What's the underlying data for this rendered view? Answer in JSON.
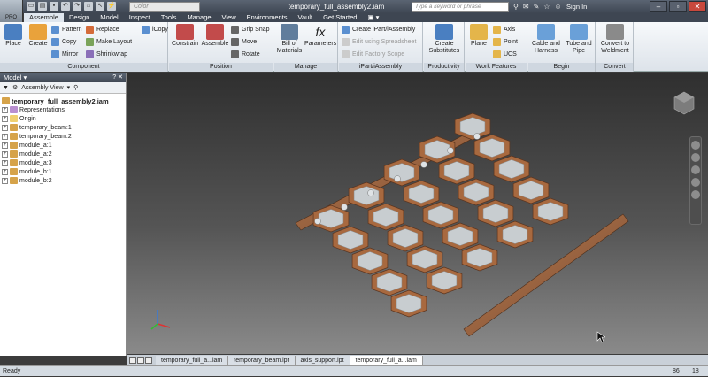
{
  "app": {
    "badge": "PRO"
  },
  "color_box": "Color",
  "document_title": "temporary_full_assembly2.iam",
  "search_placeholder": "Type a keyword or phrase",
  "sign_in": "Sign In",
  "tabs": [
    "Assemble",
    "Design",
    "Model",
    "Inspect",
    "Tools",
    "Manage",
    "View",
    "Environments",
    "Vault",
    "Get Started"
  ],
  "ribbon": {
    "component": {
      "title": "Component",
      "place": "Place",
      "create": "Create",
      "pattern": "Pattern",
      "copy": "Copy",
      "mirror": "Mirror",
      "replace": "Replace",
      "make_layout": "Make Layout",
      "shrinkwrap": "Shrinkwrap",
      "icopy": "iCopy"
    },
    "position": {
      "title": "Position",
      "constrain": "Constrain",
      "assemble": "Assemble",
      "grip_snap": "Grip Snap",
      "move": "Move",
      "rotate": "Rotate"
    },
    "manage": {
      "title": "Manage",
      "bom": "Bill of Materials",
      "parameters": "Parameters"
    },
    "ipart": {
      "title": "iPart/iAssembly",
      "create": "Create iPart/iAssembly",
      "edit_spreadsheet": "Edit using Spreadsheet",
      "edit_factory": "Edit Factory Scope"
    },
    "productivity": {
      "title": "Productivity",
      "create_substitutes": "Create Substitutes"
    },
    "work": {
      "title": "Work Features",
      "plane": "Plane",
      "axis": "Axis",
      "point": "Point",
      "ucs": "UCS"
    },
    "begin": {
      "title": "Begin",
      "cable": "Cable and Harness",
      "tube": "Tube and Pipe"
    },
    "convert": {
      "title": "Convert",
      "weldment": "Convert to Weldment"
    }
  },
  "browser": {
    "title": "Model",
    "view": "Assembly View",
    "root": "temporary_full_assembly2.iam",
    "nodes": [
      "Representations",
      "Origin",
      "temporary_beam:1",
      "temporary_beam:2",
      "module_a:1",
      "module_a:2",
      "module_a:3",
      "module_b:1",
      "module_b:2"
    ]
  },
  "doc_tabs": [
    "temporary_full_a...iam",
    "temporary_beam.ipt",
    "axis_support.ipt",
    "temporary_full_a...iam"
  ],
  "status": {
    "text": "Ready",
    "n1": "86",
    "n2": "18"
  }
}
